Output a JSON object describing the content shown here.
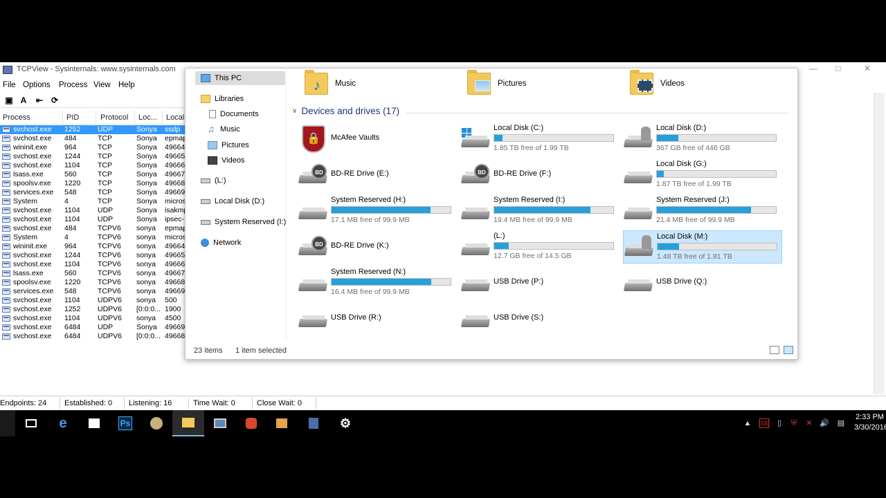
{
  "tcpview": {
    "title": "TCPView - Sysinternals: www.sysinternals.com",
    "menu": [
      "File",
      "Options",
      "Process",
      "View",
      "Help"
    ],
    "columns": [
      "Process",
      "PID",
      "Protocol",
      "Loc...",
      "Local"
    ],
    "rows": [
      {
        "process": "svchost.exe",
        "pid": "1252",
        "protocol": "UDP",
        "loc": "Sonya",
        "local": "ssdp",
        "selected": true
      },
      {
        "process": "svchost.exe",
        "pid": "484",
        "protocol": "TCP",
        "loc": "Sonya",
        "local": "epmap"
      },
      {
        "process": "wininit.exe",
        "pid": "964",
        "protocol": "TCP",
        "loc": "Sonya",
        "local": "49664"
      },
      {
        "process": "svchost.exe",
        "pid": "1244",
        "protocol": "TCP",
        "loc": "Sonya",
        "local": "49665"
      },
      {
        "process": "svchost.exe",
        "pid": "1104",
        "protocol": "TCP",
        "loc": "Sonya",
        "local": "49666"
      },
      {
        "process": "lsass.exe",
        "pid": "560",
        "protocol": "TCP",
        "loc": "Sonya",
        "local": "49667"
      },
      {
        "process": "spoolsv.exe",
        "pid": "1220",
        "protocol": "TCP",
        "loc": "Sonya",
        "local": "49668"
      },
      {
        "process": "services.exe",
        "pid": "548",
        "protocol": "TCP",
        "loc": "Sonya",
        "local": "49669"
      },
      {
        "process": "System",
        "pid": "4",
        "protocol": "TCP",
        "loc": "Sonya",
        "local": "micros"
      },
      {
        "process": "svchost.exe",
        "pid": "1104",
        "protocol": "UDP",
        "loc": "Sonya",
        "local": "isakmp"
      },
      {
        "process": "svchost.exe",
        "pid": "1104",
        "protocol": "UDP",
        "loc": "Sonya",
        "local": "ipsec-"
      },
      {
        "process": "svchost.exe",
        "pid": "484",
        "protocol": "TCPV6",
        "loc": "sonya",
        "local": "epmap"
      },
      {
        "process": "System",
        "pid": "4",
        "protocol": "TCPV6",
        "loc": "sonya",
        "local": "micros"
      },
      {
        "process": "wininit.exe",
        "pid": "964",
        "protocol": "TCPV6",
        "loc": "sonya",
        "local": "49664"
      },
      {
        "process": "svchost.exe",
        "pid": "1244",
        "protocol": "TCPV6",
        "loc": "sonya",
        "local": "49665"
      },
      {
        "process": "svchost.exe",
        "pid": "1104",
        "protocol": "TCPV6",
        "loc": "sonya",
        "local": "49666"
      },
      {
        "process": "lsass.exe",
        "pid": "560",
        "protocol": "TCPV6",
        "loc": "sonya",
        "local": "49667"
      },
      {
        "process": "spoolsv.exe",
        "pid": "1220",
        "protocol": "TCPV6",
        "loc": "sonya",
        "local": "49668"
      },
      {
        "process": "services.exe",
        "pid": "548",
        "protocol": "TCPV6",
        "loc": "sonya",
        "local": "49669"
      },
      {
        "process": "svchost.exe",
        "pid": "1104",
        "protocol": "UDPV6",
        "loc": "sonya",
        "local": "500"
      },
      {
        "process": "svchost.exe",
        "pid": "1252",
        "protocol": "UDPV6",
        "loc": "[0:0:0...",
        "local": "1900"
      },
      {
        "process": "svchost.exe",
        "pid": "1104",
        "protocol": "UDPV6",
        "loc": "sonya",
        "local": "4500"
      },
      {
        "process": "svchost.exe",
        "pid": "6484",
        "protocol": "UDP",
        "loc": "Sonya",
        "local": "49669"
      },
      {
        "process": "svchost.exe",
        "pid": "6484",
        "protocol": "UDPV6",
        "loc": "[0:0:0...",
        "local": "49668"
      }
    ],
    "status": {
      "endpoints": "Endpoints: 24",
      "established": "Established: 0",
      "listening": "Listening: 16",
      "time_wait": "Time Wait: 0",
      "close_wait": "Close Wait: 0"
    }
  },
  "explorer": {
    "nav": {
      "this_pc": "This PC",
      "libraries": "Libraries",
      "documents": "Documents",
      "music": "Music",
      "pictures": "Pictures",
      "videos": "Videos",
      "drive_l": "(L:)",
      "local_disk_d": "Local Disk (D:)",
      "system_reserved_i": "System Reserved (I:)",
      "network": "Network"
    },
    "folders": [
      "Music",
      "Pictures",
      "Videos"
    ],
    "section_title": "Devices and drives (17)",
    "drives": [
      {
        "name": "McAfee Vaults",
        "kind": "vault"
      },
      {
        "name": "Local Disk (C:)",
        "kind": "windows",
        "free": "1.85 TB free of 1.99 TB",
        "used": 0.07
      },
      {
        "name": "Local Disk (D:)",
        "kind": "user",
        "free": "367 GB free of 446 GB",
        "used": 0.18
      },
      {
        "name": "BD-RE Drive (E:)",
        "kind": "bd"
      },
      {
        "name": "BD-RE Drive (F:)",
        "kind": "bd"
      },
      {
        "name": "Local Disk (G:)",
        "kind": "hdd",
        "free": "1.87 TB free of 1.99 TB",
        "used": 0.06
      },
      {
        "name": "System Reserved (H:)",
        "kind": "hdd",
        "free": "17.1 MB free of 99.9 MB",
        "used": 0.83
      },
      {
        "name": "System Reserved (I:)",
        "kind": "hdd",
        "free": "19.4 MB free of 99.9 MB",
        "used": 0.81
      },
      {
        "name": "System Reserved (J:)",
        "kind": "hdd",
        "free": "21.4 MB free of 99.9 MB",
        "used": 0.79
      },
      {
        "name": "BD-RE Drive (K:)",
        "kind": "bd"
      },
      {
        "name": "(L:)",
        "kind": "hdd",
        "free": "12.7 GB free of 14.5 GB",
        "used": 0.12
      },
      {
        "name": "Local Disk (M:)",
        "kind": "user",
        "free": "1.48 TB free of 1.81 TB",
        "used": 0.18,
        "selected": true
      },
      {
        "name": "System Reserved (N:)",
        "kind": "hdd",
        "free": "16.4 MB free of 99.9 MB",
        "used": 0.84
      },
      {
        "name": "USB Drive (P:)",
        "kind": "hdd"
      },
      {
        "name": "USB Drive (Q:)",
        "kind": "hdd"
      },
      {
        "name": "USB Drive (R:)",
        "kind": "hdd"
      },
      {
        "name": "USB Drive (S:)",
        "kind": "hdd"
      }
    ],
    "status": {
      "items": "23 items",
      "selected": "1 item selected"
    }
  },
  "taskbar": {
    "apps": [
      "task-view",
      "edge",
      "store",
      "photoshop",
      "paint",
      "file-explorer",
      "remote-desktop",
      "tool",
      "media",
      "network-app",
      "settings"
    ],
    "clock_time": "2:33 PM",
    "clock_date": "3/30/2016",
    "ps_label": "Ps"
  },
  "colors": {
    "drive_bar_fill": "#26a0da",
    "selection": "#3399ff",
    "tile_selected": "#cce8ff"
  }
}
